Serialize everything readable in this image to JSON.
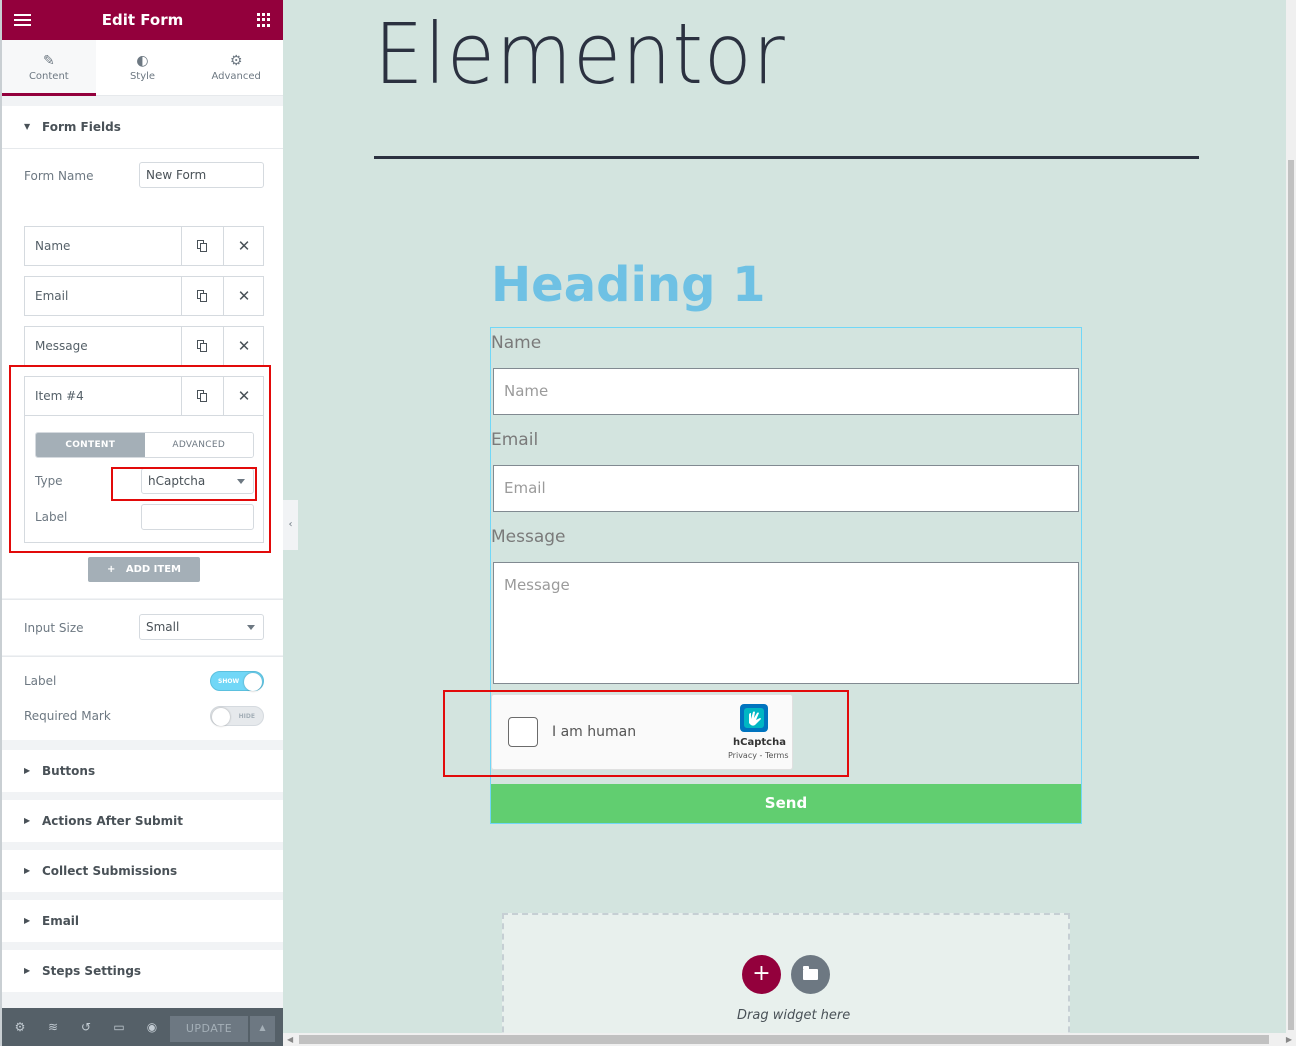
{
  "panel": {
    "title": "Edit Form",
    "tabs": [
      {
        "label": "Content",
        "icon": "pencil-icon"
      },
      {
        "label": "Style",
        "icon": "half-circle-icon"
      },
      {
        "label": "Advanced",
        "icon": "gear-icon"
      }
    ],
    "form_fields": {
      "section_title": "Form Fields",
      "form_name_label": "Form Name",
      "form_name_value": "New Form",
      "items": [
        "Name",
        "Email",
        "Message",
        "Item #4"
      ],
      "item4": {
        "subtabs": [
          "CONTENT",
          "ADVANCED"
        ],
        "type_label": "Type",
        "type_value": "hCaptcha",
        "label_label": "Label",
        "label_value": ""
      },
      "add_item_label": "ADD ITEM"
    },
    "input_size_label": "Input Size",
    "input_size_value": "Small",
    "label_switch": {
      "label": "Label",
      "state": "SHOW"
    },
    "required_mark_switch": {
      "label": "Required Mark",
      "state": "HIDE"
    },
    "sections": [
      "Buttons",
      "Actions After Submit",
      "Collect Submissions",
      "Email",
      "Steps Settings"
    ],
    "footer": {
      "update_label": "UPDATE"
    },
    "accent_color": "#93003c"
  },
  "preview": {
    "site_title": "Elementor",
    "heading": "Heading 1",
    "fields": [
      {
        "label": "Name",
        "placeholder": "Name"
      },
      {
        "label": "Email",
        "placeholder": "Email"
      },
      {
        "label": "Message",
        "placeholder": "Message"
      }
    ],
    "captcha": {
      "text": "I am human",
      "brand": "hCaptcha",
      "links": "Privacy - Terms"
    },
    "send_label": "Send",
    "dropzone_text": "Drag widget here",
    "heading_color": "#6ec1e4",
    "button_color": "#61ce70"
  }
}
